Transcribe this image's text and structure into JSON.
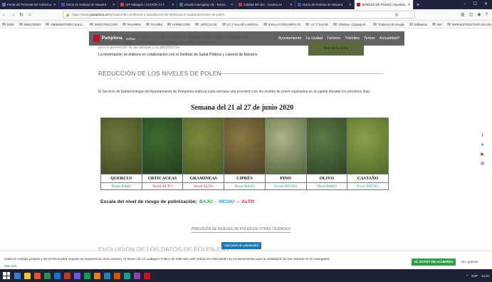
{
  "browser": {
    "tabs": [
      {
        "label": "Portal del Personal del Gobierno d...",
        "favicon_color": "#6b7bb5",
        "active": false
      },
      {
        "label": "Diario de Noticias de Navarra",
        "favicon_color": "#2c5fa8",
        "active": false
      },
      {
        "label": "UPI Malaguiz | ACCIÓN CI.T",
        "favicon_color": "#d04a3a",
        "active": false
      },
      {
        "label": "estudio-navegador.xls - Busca...",
        "favicon_color": "#3d8c4a",
        "active": false
      },
      {
        "label": "Calidad del aire - navarra.es",
        "favicon_color": "#c33b3b",
        "active": false
      },
      {
        "label": "Diario de Noticias de Navarra",
        "favicon_color": "#2c5fa8",
        "active": false
      },
      {
        "label": "NIVELES DE POLEN | Ayuntam...",
        "favicon_color": "#c0152f",
        "active": true
      }
    ],
    "url_prefix": "https://www.",
    "url_host": "pamplona.es",
    "url_path": "/temas/medio-ambiente-y-salud/punto-de-informacion-sanitaria/niveles-de-polen",
    "bookmarks": [
      "DWS",
      "MINISTERIO",
      "OBSERVATORIO SALU...",
      "INVESTIGACION",
      "NAVARRA",
      "PLANES",
      "FORMACION",
      "ARTICULOS",
      "CC Y SALUD LABORAL",
      "EVALUACION IMPACTO",
      "CC Y SALUD",
      "Chlöbien. Criptosport...",
      "Traductor de Google",
      "Biblioteca",
      "WH",
      "INFRAESTRUCTURA SALUD"
    ]
  },
  "site": {
    "brand": "Pamplona",
    "brand_sub": "Iruñea",
    "nav": [
      "Ayuntamiento",
      "La ciudad",
      "Turismo",
      "Trámites",
      "Temas",
      "Actualidad"
    ],
    "intro_lines": [
      "Los niveles de polen los proporciona el Ayuntamiento de Pamplona que elabora semanalmente",
      "la previsión de polen para la ciudad. Es importante consultar la información",
      "para la prevención de las alergias y su planificación."
    ],
    "intro_strong": "La información se elabora en colaboración con el Instituto de Salud Pública y Laboral de Navarra",
    "promo": "Bay en tu zona"
  },
  "content": {
    "section_title": "REDUCCIÓN DE LOS NIVELES DE POLEN",
    "paragraph": "El Servicio de Epidemiología del Ayuntamiento de Pamplona elabora cada semana una previsión con los niveles de polen esperados en la capital durante los próximos días.",
    "week_title": "Semana del 21 al 27 de junio 2020",
    "pollen": [
      {
        "name": "QUERCUS",
        "level": "Nivel BAJO",
        "level_color": "#1e9a3c",
        "photo": [
          "#6e7a3a",
          "#3f4b22"
        ]
      },
      {
        "name": "URTICACEAS",
        "level": "Nivel ALTO",
        "level_color": "#d61e2e",
        "photo": [
          "#3e6b30",
          "#224020"
        ]
      },
      {
        "name": "GRAMINEAS",
        "level": "Nivel ALTO",
        "level_color": "#d61e2e",
        "photo": [
          "#7a8a3c",
          "#4a5a25"
        ]
      },
      {
        "name": "CIPRÉS",
        "level": "Nivel BAJO",
        "level_color": "#1e9a3c",
        "photo": [
          "#8a7a42",
          "#4a4028"
        ]
      },
      {
        "name": "PINO",
        "level": "Nivel MEDIO",
        "level_color": "#2a9fd6",
        "photo": [
          "#a9b58a",
          "#55643a"
        ]
      },
      {
        "name": "OLIVO",
        "level": "Nivel BAJO",
        "level_color": "#1e9a3c",
        "photo": [
          "#5d7a45",
          "#2f4526"
        ]
      },
      {
        "name": "CASTAÑO",
        "level": "Nivel MEDIO",
        "level_color": "#2a9fd6",
        "photo": [
          "#8aa048",
          "#4f6a2a"
        ]
      }
    ],
    "scale_label": "Escala del nivel de riesgo de polinización:",
    "scale_low": "BAJO",
    "scale_mid": "MEDIO",
    "scale_high": "ALTO",
    "scale_sep1": "-",
    "scale_sep2": "–",
    "other_cities_link": "PREVISIÓN DE NIVELES DE POLEN EN OTRAS CIUDADES",
    "privacy_button": "Opciones de privacidad",
    "next_section_title": "EVOLUCIÓN DE LOS DATOS DE POLEN EN L..."
  },
  "cookie": {
    "text": "Usamos cookies propias y de terceros para mejorar su experiencia como usuario. Al hacer clic en cualquier enlace de este sitio web usted nos está dando su consentimiento para la instalación de las mismas en su navegador.",
    "more": "Más info",
    "accept": "SÍ, ESTOY DE ACUERDO",
    "decline": "No, gracias"
  },
  "taskbar": {
    "icons": [
      "#3a7bd5",
      "#f3c23c",
      "#e4572e",
      "#2e8b57",
      "#1f6fd1",
      "#c0392b",
      "#6c5ce7",
      "#0f9d58",
      "#e67e22",
      "#2980b9",
      "#d35400",
      "#16a085",
      "#8e44ad",
      "#c0152f"
    ],
    "tray": [
      "^",
      "ESP",
      "12:46"
    ]
  },
  "social_colors": [
    "#3b5998",
    "#1da1f2",
    "#e52d27",
    "#c13584"
  ]
}
